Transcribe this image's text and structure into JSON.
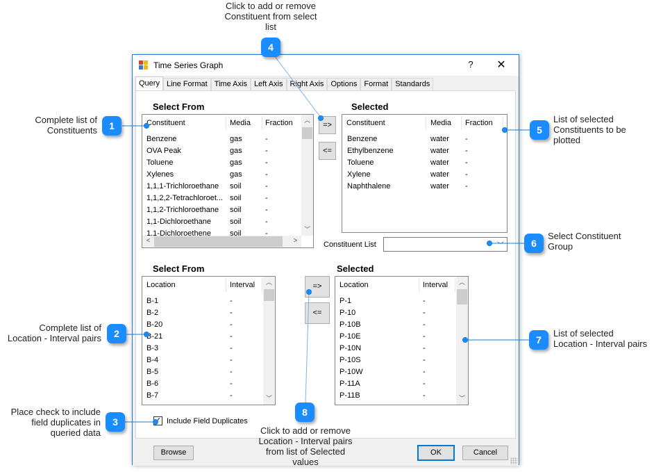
{
  "annotations": [
    {
      "num": "1",
      "text": "Complete list of Constituents",
      "lines": [
        "Complete list of",
        "Constituents"
      ]
    },
    {
      "num": "2",
      "text": "Complete list of Location - Interval pairs",
      "lines": [
        "Complete list of",
        "Location - Interval pairs"
      ]
    },
    {
      "num": "3",
      "text": "Place check to include field duplicates in queried data",
      "lines": [
        "Place check to include",
        "field duplicates in",
        "queried data"
      ]
    },
    {
      "num": "4",
      "text": "Click to add or remove Constituent from select list",
      "lines": [
        "Click to add or remove",
        "Constituent from select",
        "list"
      ]
    },
    {
      "num": "5",
      "text": "List of selected Constituents to be plotted",
      "lines": [
        "List of selected",
        "Constituents to be",
        "plotted"
      ]
    },
    {
      "num": "6",
      "text": "Select Constituent Group",
      "lines": [
        "Select Constituent",
        "Group"
      ]
    },
    {
      "num": "7",
      "text": "List of selected Location - Interval pairs",
      "lines": [
        "List of selected",
        "Location - Interval pairs"
      ]
    },
    {
      "num": "8",
      "text": "Click to add or remove Location - Interval pairs from list of Selected values",
      "lines": [
        "Click to add or remove",
        "Location - Interval pairs",
        "from list of Selected",
        "values"
      ]
    }
  ],
  "window": {
    "title": "Time Series Graph",
    "help_label": "?",
    "close_label": "✕",
    "icon": "app-window-icon"
  },
  "tabs": [
    "Query",
    "Line Format",
    "Time Axis",
    "Left Axis",
    "Right Axis",
    "Options",
    "Format",
    "Standards"
  ],
  "active_tab": "Query",
  "constituents": {
    "select_from_title": "Select From",
    "selected_title": "Selected",
    "columns": [
      "Constituent",
      "Media",
      "Fraction"
    ],
    "available": [
      [
        "Benzene",
        "gas",
        "-"
      ],
      [
        "OVA Peak",
        "gas",
        "-"
      ],
      [
        "Toluene",
        "gas",
        "-"
      ],
      [
        "Xylenes",
        "gas",
        "-"
      ],
      [
        "1,1,1-Trichloroethane",
        "soil",
        "-"
      ],
      [
        "1,1,2,2-Tetrachloroet...",
        "soil",
        "-"
      ],
      [
        "1,1,2-Trichloroethane",
        "soil",
        "-"
      ],
      [
        "1,1-Dichloroethane",
        "soil",
        "-"
      ],
      [
        "1,1-Dichloroethene",
        "soil",
        "-"
      ]
    ],
    "selected": [
      [
        "Benzene",
        "water",
        "-"
      ],
      [
        "Ethylbenzene",
        "water",
        "-"
      ],
      [
        "Toluene",
        "water",
        "-"
      ],
      [
        "Xylene",
        "water",
        "-"
      ],
      [
        "Naphthalene",
        "water",
        "-"
      ]
    ],
    "add_label": "=>",
    "remove_label": "<=",
    "list_label": "Constituent List",
    "list_value": ""
  },
  "locations": {
    "select_from_title": "Select From",
    "selected_title": "Selected",
    "columns": [
      "Location",
      "Interval"
    ],
    "available": [
      [
        "B-1",
        "-"
      ],
      [
        "B-2",
        "-"
      ],
      [
        "B-20",
        "-"
      ],
      [
        "B-21",
        "-"
      ],
      [
        "B-3",
        "-"
      ],
      [
        "B-4",
        "-"
      ],
      [
        "B-5",
        "-"
      ],
      [
        "B-6",
        "-"
      ],
      [
        "B-7",
        "-"
      ]
    ],
    "selected": [
      [
        "P-1",
        "-"
      ],
      [
        "P-10",
        "-"
      ],
      [
        "P-10B",
        "-"
      ],
      [
        "P-10E",
        "-"
      ],
      [
        "P-10N",
        "-"
      ],
      [
        "P-10S",
        "-"
      ],
      [
        "P-10W",
        "-"
      ],
      [
        "P-11A",
        "-"
      ],
      [
        "P-11B",
        "-"
      ]
    ],
    "add_label": "=>",
    "remove_label": "<="
  },
  "include_duplicates": {
    "label": "Include Field Duplicates",
    "checked": true,
    "mark": "✓"
  },
  "footer": {
    "browse_label": "Browse",
    "ok_label": "OK",
    "cancel_label": "Cancel"
  },
  "scroll_glyphs": {
    "up": "︿",
    "down": "﹀",
    "left": "<",
    "right": ">"
  },
  "colors": {
    "accent": "#1a8cff",
    "window_border": "#2b7bd8"
  }
}
